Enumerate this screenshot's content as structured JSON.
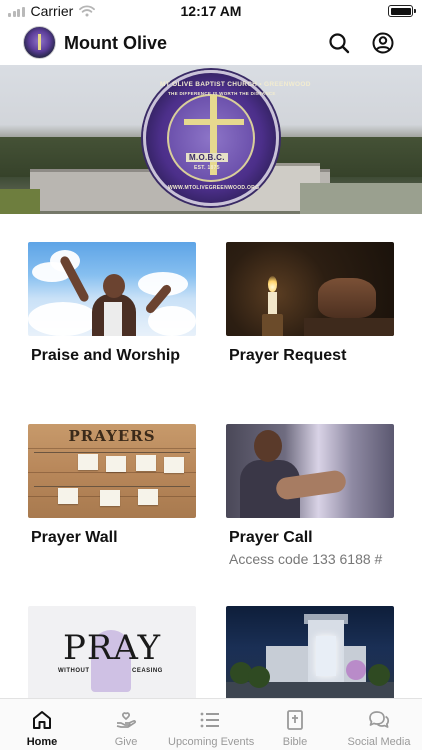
{
  "status_bar": {
    "carrier": "Carrier",
    "time": "12:17 AM"
  },
  "header": {
    "title": "Mount Olive",
    "avatar_icon": "church-logo-avatar",
    "search_icon": "search-icon",
    "account_icon": "account-icon"
  },
  "banner": {
    "seal_top_text": "MT OLIVE BAPTIST CHURCH • GREENWOOD",
    "seal_motto": "THE DIFFERENCE IS WORTH THE DISTANCE",
    "seal_initials": "M.O.B.C.",
    "seal_est": "EST. 1875",
    "seal_url": "WWW.MTOLIVEGREENWOOD.ORG"
  },
  "tiles": [
    {
      "label": "Praise and Worship",
      "subtitle": ""
    },
    {
      "label": "Prayer Request",
      "subtitle": ""
    },
    {
      "label": "Prayer Wall",
      "subtitle": "",
      "image_text": "PRAYERS"
    },
    {
      "label": "Prayer Call",
      "subtitle": "Access code 133 6188 #"
    },
    {
      "label": "",
      "subtitle": "",
      "image_text": "PRAY",
      "image_sub_left": "WITHOUT",
      "image_sub_right": "CEASING"
    },
    {
      "label": "",
      "subtitle": ""
    }
  ],
  "bottom_nav": [
    {
      "label": "Home",
      "icon": "home-icon",
      "active": true
    },
    {
      "label": "Give",
      "icon": "give-hand-heart-icon",
      "active": false
    },
    {
      "label": "Upcoming Events",
      "icon": "list-icon",
      "active": false
    },
    {
      "label": "Bible",
      "icon": "bible-icon",
      "active": false
    },
    {
      "label": "Social Media",
      "icon": "chat-bubbles-icon",
      "active": false
    }
  ],
  "colors": {
    "active_nav": "#111111",
    "inactive_nav": "#9a9a9a",
    "seal_purple": "#5b3d98"
  }
}
